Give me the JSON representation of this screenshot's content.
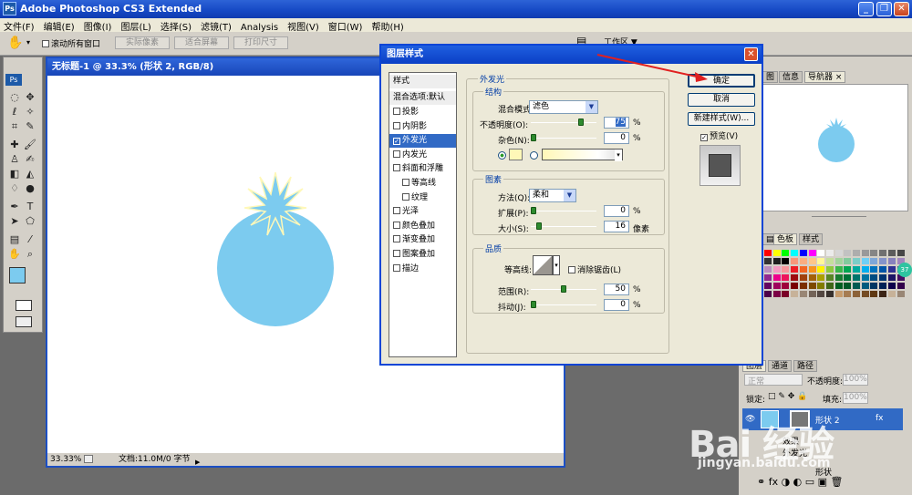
{
  "app": {
    "title": "Adobe Photoshop CS3 Extended",
    "logo": "Ps",
    "colors": {
      "titlebar": "#1548c4",
      "selection": "#316ac5",
      "shape": "#7ccbef",
      "glow": "#fff8b8"
    }
  },
  "menu": [
    "文件(F)",
    "编辑(E)",
    "图像(I)",
    "图层(L)",
    "选择(S)",
    "滤镜(T)",
    "Analysis",
    "视图(V)",
    "窗口(W)",
    "帮助(H)"
  ],
  "options": {
    "scroll_all": "滚动所有窗口",
    "actual_pixels": "实际像素",
    "fit_screen": "适合屏幕",
    "print_size": "打印尺寸",
    "workspace": "工作区 ▼"
  },
  "document": {
    "title": "无标题-1 @ 33.3% (形状 2, RGB/8)",
    "zoom": "33.33%",
    "doc_size": "文档:11.0M/0 字节"
  },
  "dialog": {
    "title": "图层样式",
    "styles_header": "样式",
    "blend_header": "混合选项:默认",
    "style_items": [
      {
        "label": "投影",
        "checked": false
      },
      {
        "label": "内阴影",
        "checked": false
      },
      {
        "label": "外发光",
        "checked": true
      },
      {
        "label": "内发光",
        "checked": false
      },
      {
        "label": "斜面和浮雕",
        "checked": false
      },
      {
        "label": "等高线",
        "checked": false
      },
      {
        "label": "纹理",
        "checked": false
      },
      {
        "label": "光泽",
        "checked": false
      },
      {
        "label": "颜色叠加",
        "checked": false
      },
      {
        "label": "渐变叠加",
        "checked": false
      },
      {
        "label": "图案叠加",
        "checked": false
      },
      {
        "label": "描边",
        "checked": false
      }
    ],
    "section_title": "外发光",
    "structure": {
      "label": "结构",
      "blend_mode_label": "混合模式:",
      "blend_mode": "滤色",
      "opacity_label": "不透明度(O):",
      "opacity": "75",
      "noise_label": "杂色(N):",
      "noise": "0",
      "percent": "%"
    },
    "elements": {
      "label": "图素",
      "method_label": "方法(Q):",
      "method": "柔和",
      "spread_label": "扩展(P):",
      "spread": "0",
      "size_label": "大小(S):",
      "size": "16",
      "px": "像素"
    },
    "quality": {
      "label": "品质",
      "contour_label": "等高线:",
      "antialias_label": "消除锯齿(L)",
      "range_label": "范围(R):",
      "range": "50",
      "jitter_label": "抖动(J):",
      "jitter": "0"
    },
    "buttons": {
      "ok": "确定",
      "cancel": "取消",
      "new_style": "新建样式(W)...",
      "preview": "预览(V)"
    }
  },
  "panels": {
    "nav_tabs": [
      "图",
      "信息",
      "导航器 ×"
    ],
    "color_tabs": [
      "色板",
      "样式"
    ],
    "layer_tabs": [
      "图层",
      "通道",
      "路径"
    ],
    "blend_mode": "正常",
    "opacity_label": "不透明度:",
    "opacity": "100%",
    "lock_label": "锁定:",
    "fill_label": "填充:",
    "fill": "100%",
    "layers": [
      {
        "name": "形状 2"
      },
      {
        "name": "效果"
      },
      {
        "name": "外发光"
      },
      {
        "name": "形状"
      }
    ]
  },
  "watermark": {
    "brand": "Bai 经验",
    "url": "jingyan.baidu.com"
  }
}
